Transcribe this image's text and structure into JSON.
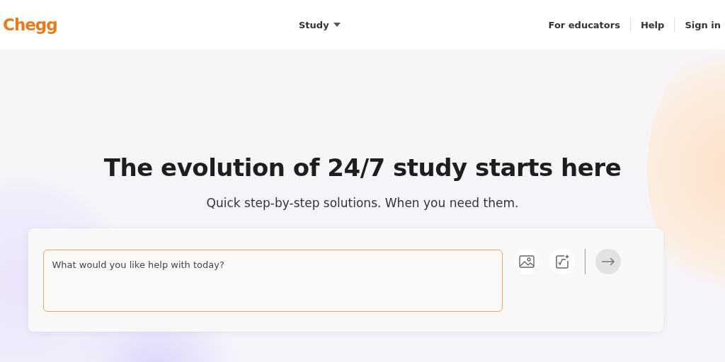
{
  "header": {
    "logo": "Chegg",
    "nav": [
      {
        "label": "Study"
      }
    ],
    "links": [
      "For educators",
      "Help",
      "Sign in"
    ]
  },
  "hero": {
    "title": "The evolution of 24/7 study starts here",
    "subtitle": "Quick step-by-step solutions. When you need them."
  },
  "question_box": {
    "placeholder": "What would you like help with today?"
  }
}
